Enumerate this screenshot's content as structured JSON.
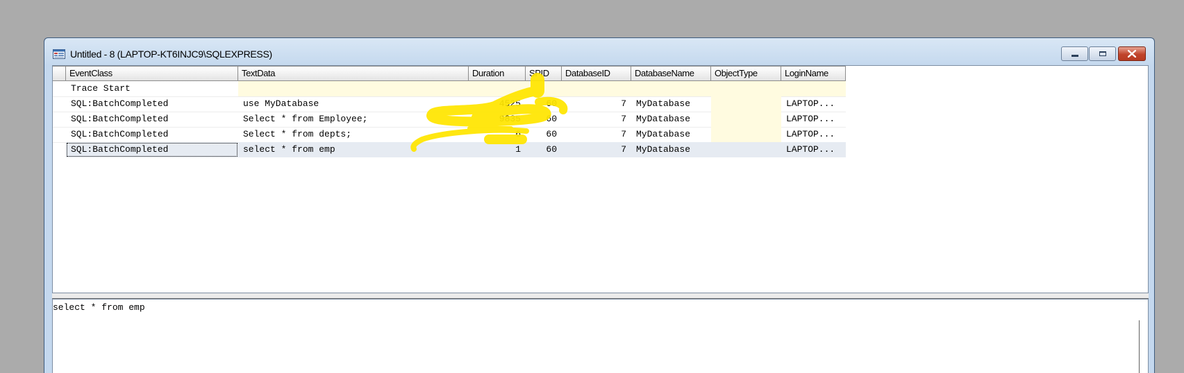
{
  "window": {
    "title": "Untitled - 8 (LAPTOP-KT6INJC9\\SQLEXPRESS)",
    "controls": {
      "minimize": "minimize",
      "maximize": "maximize",
      "close": "close"
    }
  },
  "grid": {
    "columns": [
      "EventClass",
      "TextData",
      "Duration",
      "SPID",
      "DatabaseID",
      "DatabaseName",
      "ObjectType",
      "LoginName"
    ],
    "rows": [
      {
        "event_class": "Trace Start",
        "text_data": "",
        "duration": "",
        "spid": "",
        "database_id": "",
        "database_name": "",
        "object_type": "",
        "login_name": ""
      },
      {
        "event_class": "SQL:BatchCompleted",
        "text_data": "use MyDatabase",
        "duration": "4525",
        "spid": "60",
        "database_id": "7",
        "database_name": "MyDatabase",
        "object_type": "",
        "login_name": "LAPTOP..."
      },
      {
        "event_class": "SQL:BatchCompleted",
        "text_data": "Select * from Employee;",
        "duration": "9835",
        "spid": "60",
        "database_id": "7",
        "database_name": "MyDatabase",
        "object_type": "",
        "login_name": "LAPTOP..."
      },
      {
        "event_class": "SQL:BatchCompleted",
        "text_data": "Select * from depts;",
        "duration": "6",
        "spid": "60",
        "database_id": "7",
        "database_name": "MyDatabase",
        "object_type": "",
        "login_name": "LAPTOP..."
      },
      {
        "event_class": "SQL:BatchCompleted",
        "text_data": "select * from emp",
        "duration": "1",
        "spid": "60",
        "database_id": "7",
        "database_name": "MyDatabase",
        "object_type": "",
        "login_name": "LAPTOP..."
      }
    ],
    "selected_row": 4
  },
  "details": {
    "text": "select * from emp"
  },
  "colors": {
    "highlighter": "#ffe600",
    "selected_row": "#e6ebf2",
    "pale_yellow": "#fffbe0",
    "close_button": "#c0442b"
  }
}
